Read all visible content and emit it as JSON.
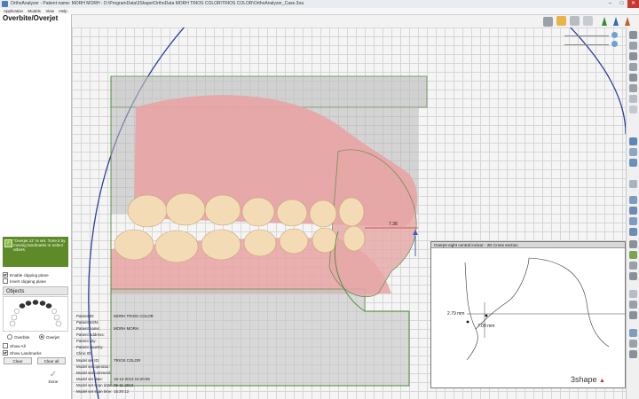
{
  "window": {
    "title": "OrthoAnalyzer - Patient name: MORH MORH - D:\\ProgramData\\3Shape\\OrthoData MORH TRIOS COLOR\\TRIOS COLOR\\OrthoAnalyzer_Case.3oa",
    "buttons": {
      "minimize": "–",
      "maximize": "□",
      "close": "✕"
    }
  },
  "menu": [
    "Application",
    "Models",
    "View",
    "Help"
  ],
  "left_panel": {
    "title": "Overbite/Overjet",
    "message": "\"Overjet 11\" is set. Tune it by moving landmarks or select others.",
    "message_icon": "✓",
    "clipping": [
      {
        "label": "Enable clipping plane",
        "checked": true
      },
      {
        "label": "Invert clipping plane",
        "checked": false
      }
    ],
    "objects_header": "Objects",
    "modes": [
      {
        "label": "Overbite",
        "selected": false
      },
      {
        "label": "Overjet",
        "selected": true
      }
    ],
    "show": [
      {
        "label": "Show All",
        "checked": false
      },
      {
        "label": "Show Landmarks",
        "checked": true
      }
    ],
    "buttons": {
      "clear": "Clear",
      "clear_all": "Clear all"
    },
    "done": {
      "icon": "✓",
      "label": "Done"
    }
  },
  "patient_info": [
    {
      "label": "Patient ID:",
      "value": "MORH TRIOS COLOR"
    },
    {
      "label": "Patient SSN:",
      "value": ""
    },
    {
      "label": "Patient name:",
      "value": "MORH MORH"
    },
    {
      "label": "Patient address:",
      "value": ""
    },
    {
      "label": "Patient city:",
      "value": ""
    },
    {
      "label": "Patient country:",
      "value": ""
    },
    {
      "label": "Clinic ID:",
      "value": ""
    }
  ],
  "model_info": [
    {
      "label": "Model set ID:",
      "value": "TRIOS COLOR"
    },
    {
      "label": "Model set operator:",
      "value": ""
    },
    {
      "label": "Model set comment:",
      "value": ""
    },
    {
      "label": "Model set date:",
      "value": "16-12-2013 16:20:05"
    },
    {
      "label": "Model set scan date:",
      "value": "05-11-2013"
    },
    {
      "label": "Model set scan time:",
      "value": "15:20:12"
    }
  ],
  "measurement_3d": "7.38",
  "cross_section": {
    "title": "Overjet eight central incisor - 2D Cross section",
    "overjet": "7.08 mm",
    "overbite": "2.79 mm"
  },
  "brand": "3shape",
  "brand_mark": "▲",
  "colors": {
    "accent_green": "#5e8a28",
    "gum": "#e8a3a3",
    "teeth": "#f3dcb5",
    "arc": "#2d3f99",
    "plane": "#6fa55a"
  }
}
